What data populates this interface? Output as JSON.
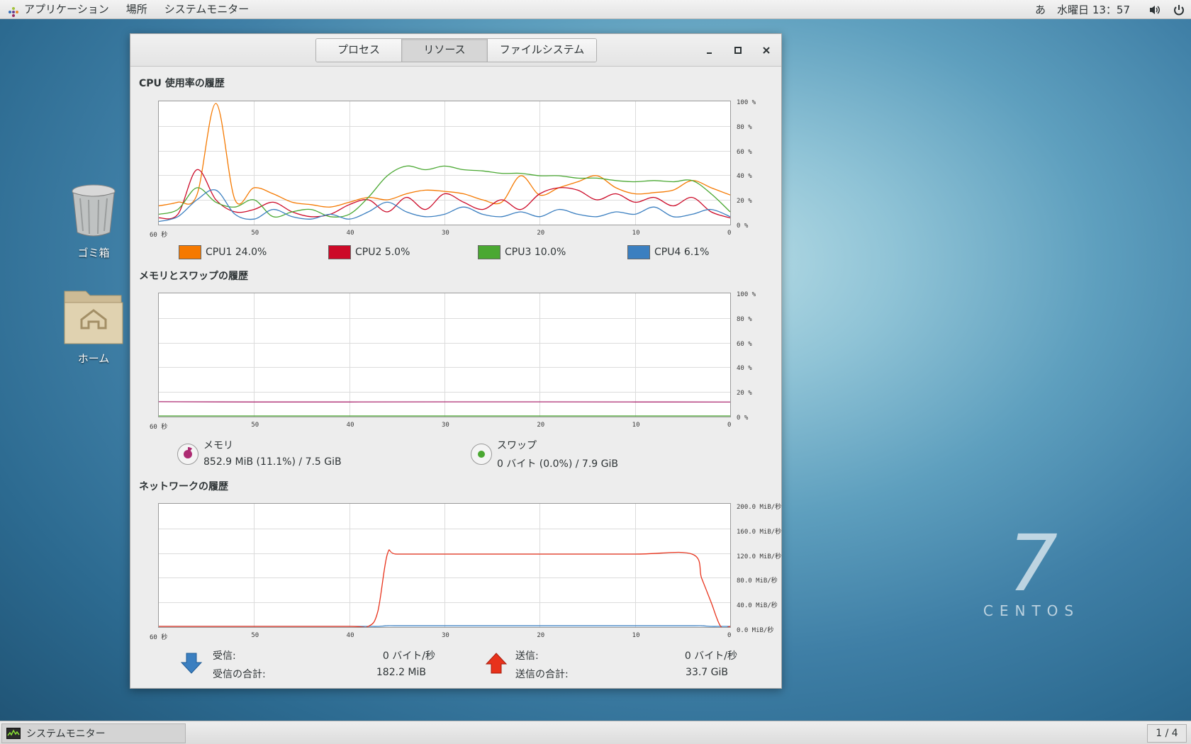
{
  "topbar": {
    "applications": "アプリケーション",
    "places": "場所",
    "app_menu": "システムモニター",
    "input_method": "あ",
    "clock": "水曜日 13：57"
  },
  "desktop": {
    "trash_label": "ゴミ箱",
    "home_label": "ホーム",
    "brand_number": "7",
    "brand_name": "CENTOS"
  },
  "window": {
    "tabs": [
      "プロセス",
      "リソース",
      "ファイルシステム"
    ],
    "active_tab": "リソース",
    "cpu": {
      "title": "CPU 使用率の履歴",
      "y_ticks": [
        "100 %",
        "80 %",
        "60 %",
        "40 %",
        "20 %",
        "0 %"
      ],
      "x_ticks": [
        "60 秒",
        "50",
        "40",
        "30",
        "20",
        "10",
        "0"
      ],
      "legend": [
        {
          "name": "CPU1",
          "value": "24.0%",
          "color": "#f57900"
        },
        {
          "name": "CPU2",
          "value": "5.0%",
          "color": "#cc0a28"
        },
        {
          "name": "CPU3",
          "value": "10.0%",
          "color": "#4aa832"
        },
        {
          "name": "CPU4",
          "value": "6.1%",
          "color": "#3b7fc0"
        }
      ]
    },
    "memory": {
      "title": "メモリとスワップの履歴",
      "y_ticks": [
        "100 %",
        "80 %",
        "60 %",
        "40 %",
        "20 %",
        "0 %"
      ],
      "x_ticks": [
        "60 秒",
        "50",
        "40",
        "30",
        "20",
        "10",
        "0"
      ],
      "mem_label": "メモリ",
      "mem_value": "852.9 MiB (11.1%) / 7.5 GiB",
      "mem_color": "#ad2b72",
      "swap_label": "スワップ",
      "swap_value": "0 バイト (0.0%) / 7.9 GiB",
      "swap_color": "#4aa832"
    },
    "network": {
      "title": "ネットワークの履歴",
      "y_ticks": [
        "200.0 MiB/秒",
        "160.0 MiB/秒",
        "120.0 MiB/秒",
        "80.0 MiB/秒",
        "40.0 MiB/秒",
        "0.0 MiB/秒"
      ],
      "x_ticks": [
        "60 秒",
        "50",
        "40",
        "30",
        "20",
        "10",
        "0"
      ],
      "recv_label": "受信:",
      "recv_value": "0 バイト/秒",
      "recv_total_label": "受信の合計:",
      "recv_total_value": "182.2 MiB",
      "send_label": "送信:",
      "send_value": "0 バイト/秒",
      "send_total_label": "送信の合計:",
      "send_total_value": "33.7 GiB",
      "recv_color": "#3b7fc0",
      "send_color": "#e8321b"
    }
  },
  "bottombar": {
    "task_label": "システムモニター",
    "pager": "1 / 4"
  },
  "chart_data": [
    {
      "type": "line",
      "title": "CPU 使用率の履歴",
      "x": [
        60,
        58,
        56,
        54,
        52,
        50,
        48,
        46,
        44,
        42,
        40,
        38,
        36,
        34,
        32,
        30,
        28,
        26,
        24,
        22,
        20,
        18,
        16,
        14,
        12,
        10,
        8,
        6,
        4,
        2,
        0
      ],
      "ylim": [
        0,
        100
      ],
      "series": [
        {
          "name": "CPU1",
          "values": [
            15,
            18,
            24,
            100,
            20,
            30,
            25,
            18,
            16,
            14,
            18,
            22,
            20,
            25,
            28,
            27,
            25,
            20,
            18,
            40,
            24,
            30,
            35,
            40,
            30,
            25,
            26,
            28,
            36,
            30,
            24
          ]
        },
        {
          "name": "CPU2",
          "values": [
            5,
            8,
            45,
            20,
            10,
            12,
            18,
            10,
            6,
            8,
            16,
            20,
            10,
            22,
            12,
            25,
            18,
            12,
            20,
            12,
            25,
            30,
            28,
            20,
            25,
            18,
            22,
            15,
            22,
            10,
            5
          ]
        },
        {
          "name": "CPU3",
          "values": [
            8,
            12,
            30,
            18,
            14,
            20,
            6,
            10,
            12,
            6,
            8,
            22,
            40,
            48,
            45,
            48,
            45,
            44,
            42,
            42,
            40,
            40,
            38,
            38,
            36,
            35,
            36,
            35,
            36,
            25,
            10
          ]
        },
        {
          "name": "CPU4",
          "values": [
            2,
            6,
            20,
            28,
            8,
            4,
            12,
            6,
            4,
            8,
            4,
            10,
            18,
            10,
            6,
            8,
            14,
            8,
            6,
            10,
            6,
            12,
            8,
            6,
            10,
            8,
            14,
            6,
            8,
            12,
            6
          ]
        }
      ]
    },
    {
      "type": "line",
      "title": "メモリとスワップの履歴",
      "x": [
        60,
        50,
        40,
        30,
        20,
        10,
        0
      ],
      "ylim": [
        0,
        100
      ],
      "series": [
        {
          "name": "メモリ",
          "values": [
            11.8,
            11.6,
            11.6,
            11.7,
            11.7,
            11.6,
            11.5
          ]
        },
        {
          "name": "スワップ",
          "values": [
            0,
            0,
            0,
            0,
            0,
            0,
            0
          ]
        }
      ]
    },
    {
      "type": "line",
      "title": "ネットワークの履歴",
      "x": [
        60,
        50,
        40,
        38,
        37,
        36,
        35,
        30,
        20,
        10,
        4,
        3,
        2,
        1,
        0
      ],
      "ylim": [
        0,
        200
      ],
      "ylabel": "MiB/秒",
      "series": [
        {
          "name": "受信",
          "values": [
            0,
            0,
            0,
            0,
            0,
            1,
            1,
            1,
            1,
            1,
            1,
            1,
            0,
            0,
            0
          ]
        },
        {
          "name": "送信",
          "values": [
            0,
            0,
            0,
            0,
            25,
            120,
            120,
            120,
            120,
            120,
            120,
            80,
            40,
            0,
            0
          ]
        }
      ]
    }
  ]
}
